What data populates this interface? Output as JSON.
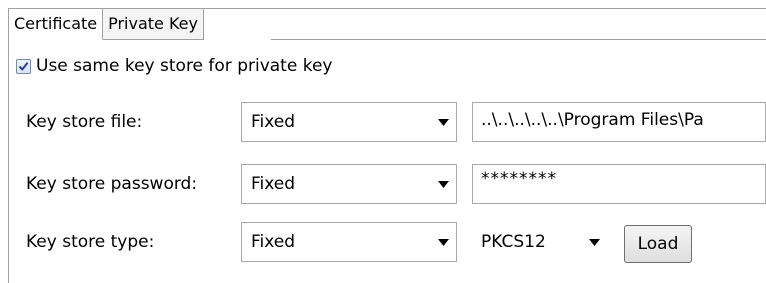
{
  "tabs": [
    {
      "label": "Certificate",
      "active": true
    },
    {
      "label": "Private Key",
      "active": false
    }
  ],
  "use_same_keystore": {
    "label": "Use same key store for private key",
    "checked": true
  },
  "rows": {
    "file": {
      "label": "Key store file:",
      "mode": "Fixed",
      "value": "..\\..\\..\\..\\..\\Program Files\\Pa"
    },
    "password": {
      "label": "Key store password:",
      "mode": "Fixed",
      "value": "********"
    },
    "type": {
      "label": "Key store type:",
      "mode": "Fixed",
      "value": "PKCS12",
      "load_label": "Load"
    }
  },
  "icons": {
    "checkbox_check": "check-icon",
    "dropdown_arrow": "chevron-down-icon"
  }
}
